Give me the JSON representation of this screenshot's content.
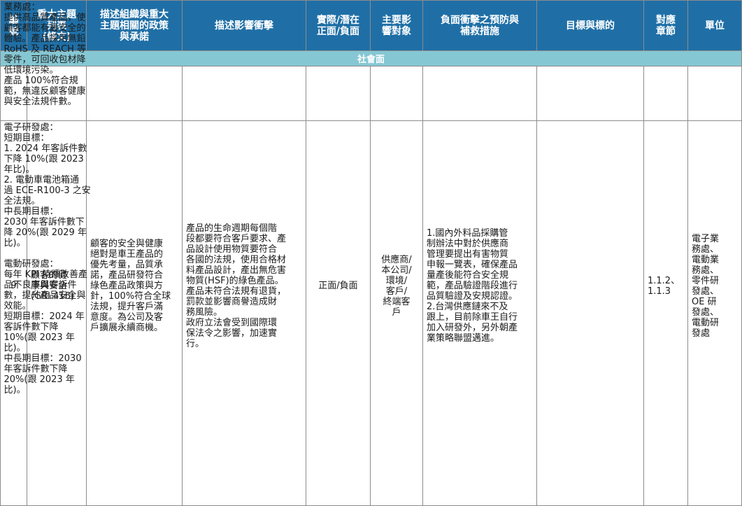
{
  "headers": {
    "no": "編\n號",
    "topic": "重大主題\n列表\n(條文)",
    "policy": "描述組織與重大\n主題相關的政策\n與承諾",
    "impact": "描述影響衝擊",
    "nature": "實際/潛在\n正面/負面",
    "target": "主要影\n響對象",
    "measures": "負面衝擊之預防與\n補救措施",
    "goals": "目標與標的",
    "chapter": "對應\n章節",
    "unit": "單位"
  },
  "section_title": "社會面",
  "row": {
    "no": "9",
    "topic": "顧客的健\n康與安全\n(GRI 416)",
    "policy": "顧客的安全與健康\n絕對是車王產品的\n優先考量，品質承\n諾，產品研發符合\n綠色產品政策與方\n針，100%符合全球\n法規，提升客戶滿\n意度。為公司及客\n戶擴展永續商機。",
    "impact": "產品的生命週期每個階\n段都要符合客戶要求、產\n品設計使用物質要符合\n各國的法規，使用合格材\n料產品設計，產出無危害\n物質(HSF)的綠色產品。\n產品未符合法規有退貨，\n罰款並影響商譽造成財\n務風險。\n政府立法會受到國際環\n保法令之影響，加速實\n行。",
    "nature": "正面/負面",
    "target": "供應商/\n本公司/\n環境/\n客戶/\n終端客\n戶",
    "measures": "1.國內外料品採購管\n制辦法中對於供應商\n管理要提出有害物質\n申報一覽表，確保產品\n量產後能符合安全規\n範，產品驗證階段進行\n品質驗證及安規認證。\n2.台灣供應鏈來不及\n跟上，目前除車王自行\n加入研發外，另外朝產\n業策略聯盟邁進。",
    "goals_1": "業務處：\n提供高品質產品，使\n顧客都能有最安全的\n體驗。產品採用無鉛\nRoHS 及 REACH 等\n零件，可回收包材降\n低環境污染。\n產品 100%符合規\n範，無違反顧客健康\n與安全法規件數。",
    "goals_2": "電子研發處：\n短期目標：\n1. 2024 年客訴件數\n下降 10%(跟 2023\n年比)。\n2. 電動車電池箱通\n過 ECE-R100-3 之安\n全法規。\n中長期目標：\n2030 年客訴件數下\n降 20%(跟 2029 年\n比)。\n\n電動研發處：\n每年 KPI 持續改善產\n品不良率與客訴件\n數，提升產品安全與\n效能。\n短期目標：2024 年\n客訴件數下降\n10%(跟 2023 年\n比)。\n中長期目標：2030\n年客訴件數下降\n20%(跟 2023 年\n比)。",
    "chapter": "1.1.2、\n1.1.3",
    "unit": "電子業\n務處、\n電動業\n務處、\n零件研\n發處、\nOE 研\n發處、\n電動研\n發處"
  }
}
